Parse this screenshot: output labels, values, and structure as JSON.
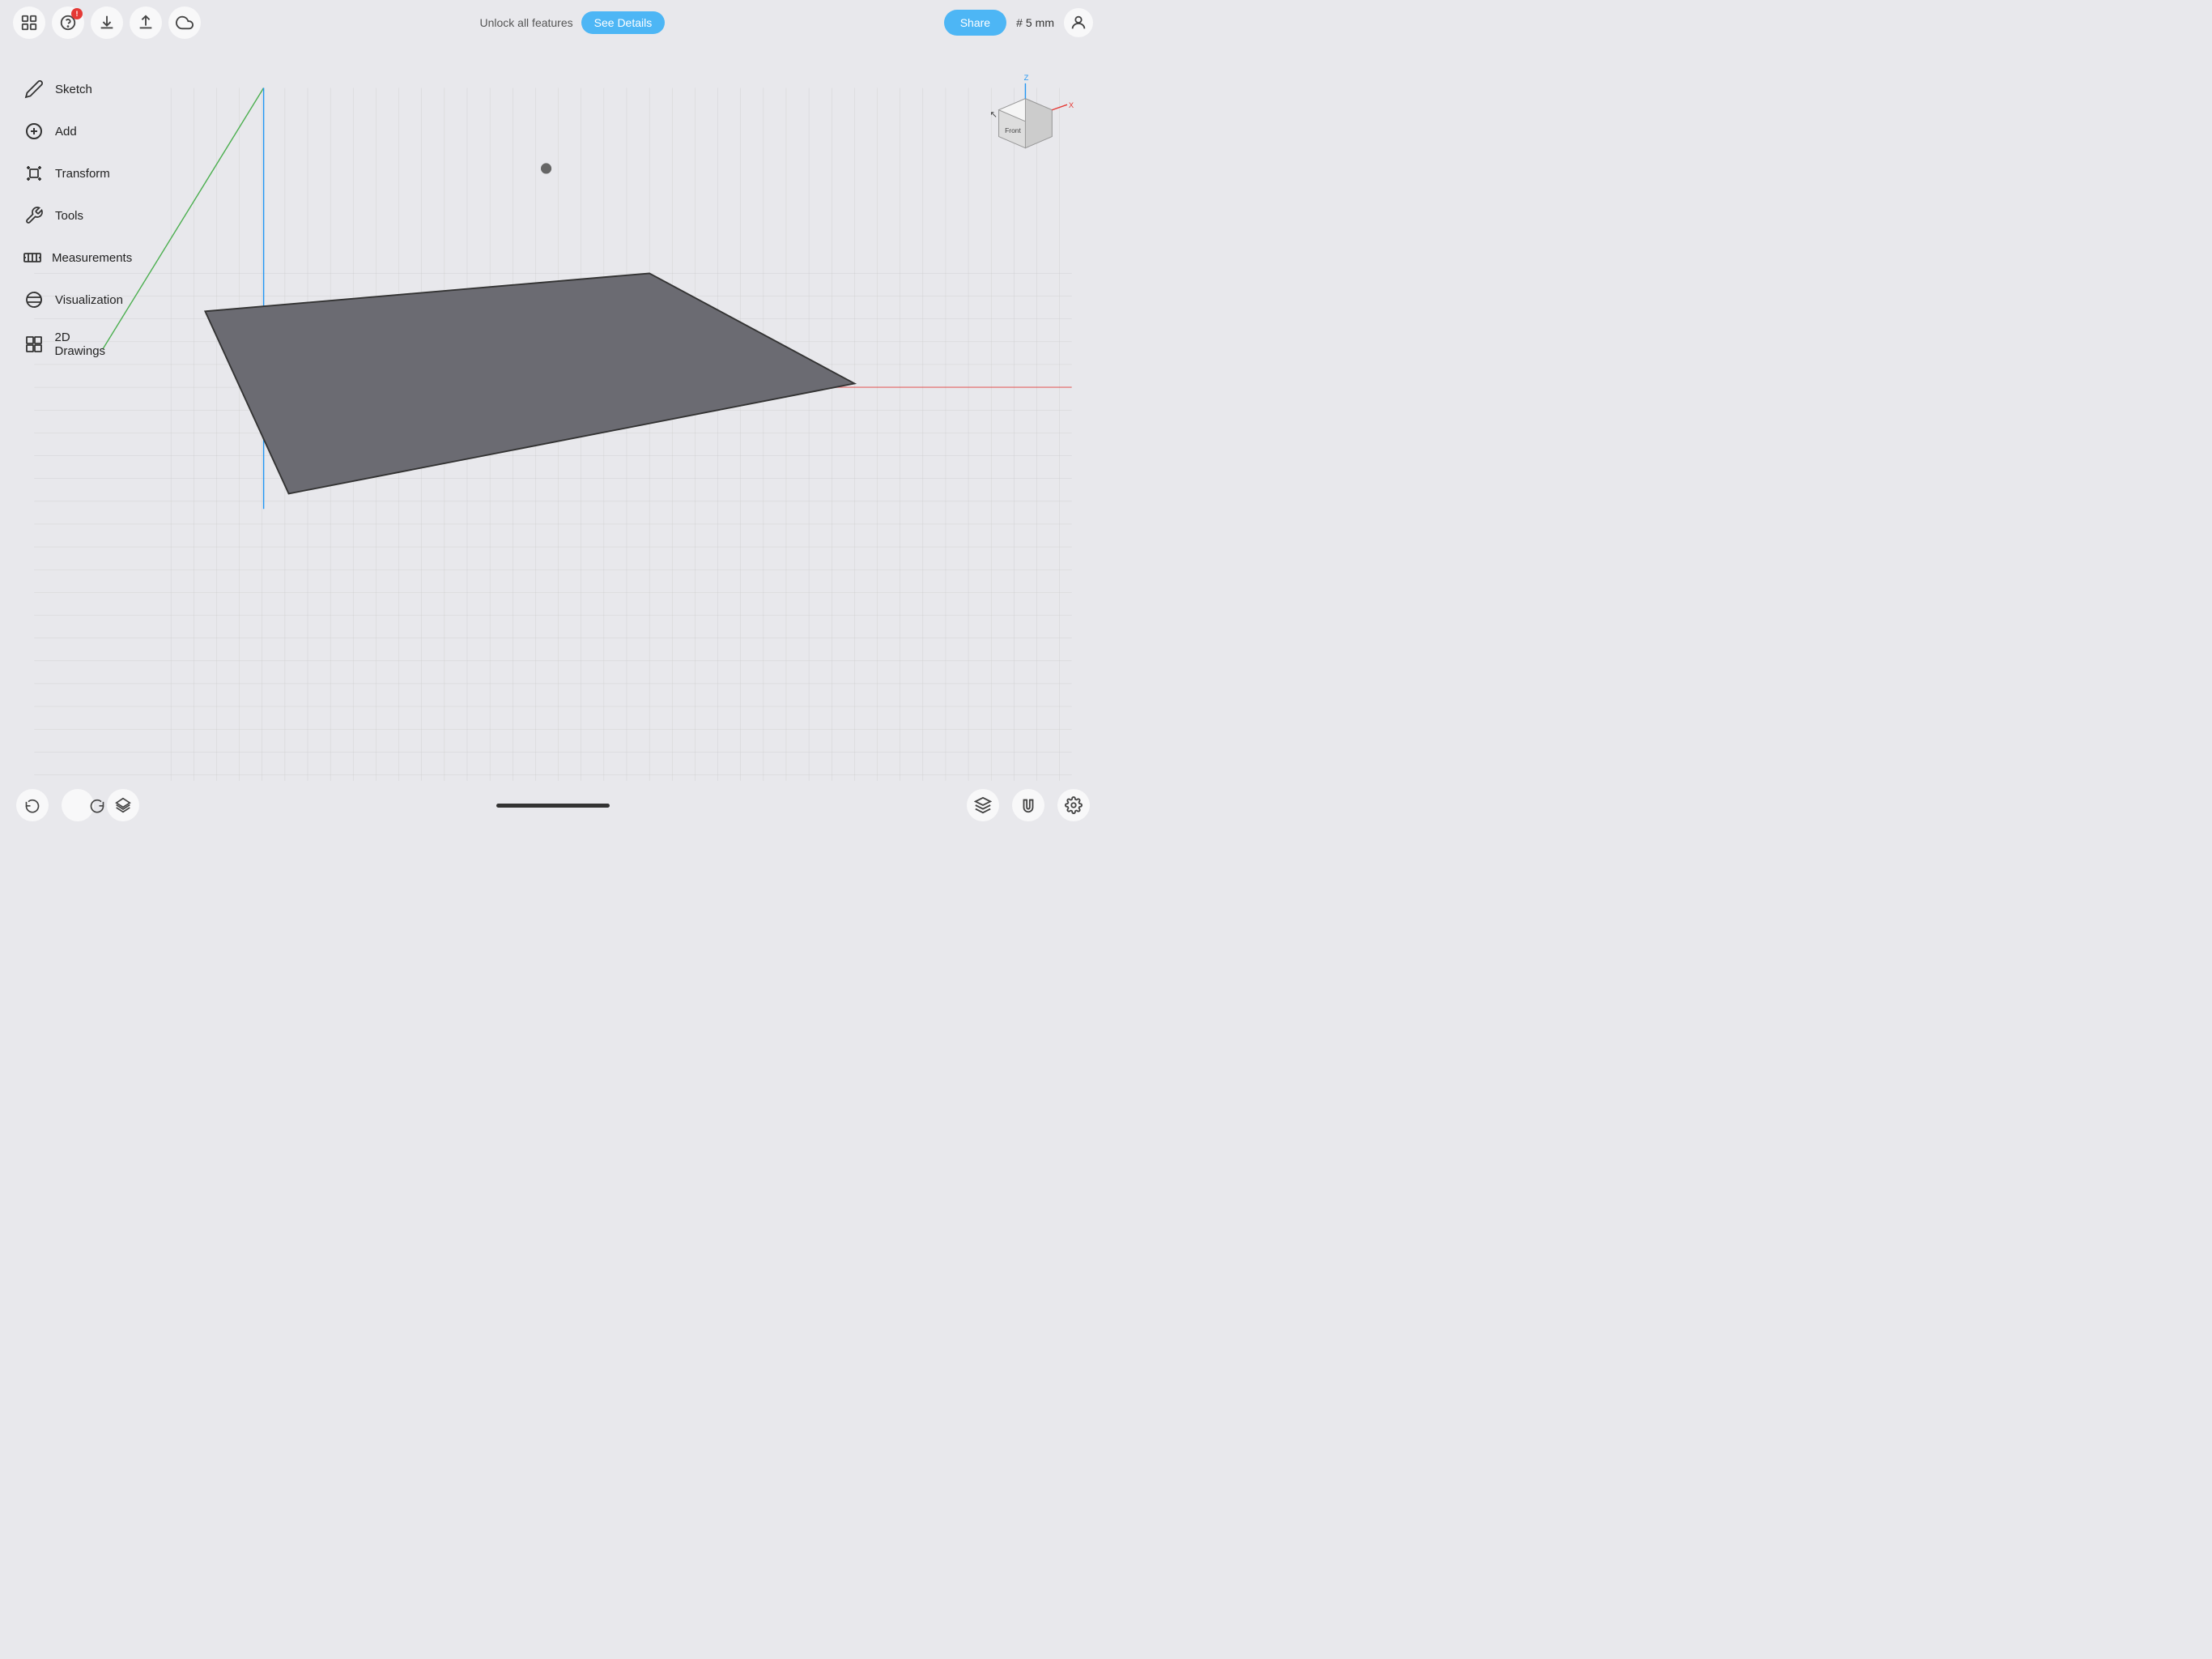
{
  "toolbar": {
    "share_label": "Share",
    "unlock_text": "Unlock all features",
    "see_details_label": "See Details",
    "measurement": {
      "hash": "#",
      "value": "5",
      "unit": "mm"
    }
  },
  "sidebar": {
    "items": [
      {
        "id": "sketch",
        "label": "Sketch",
        "icon": "pencil"
      },
      {
        "id": "add",
        "label": "Add",
        "icon": "plus"
      },
      {
        "id": "transform",
        "label": "Transform",
        "icon": "transform"
      },
      {
        "id": "tools",
        "label": "Tools",
        "icon": "wrench"
      },
      {
        "id": "measurements",
        "label": "Measurements",
        "icon": "measurements"
      },
      {
        "id": "visualization",
        "label": "Visualization",
        "icon": "visualization"
      },
      {
        "id": "2d-drawings",
        "label": "2D Drawings",
        "icon": "drawings"
      }
    ]
  },
  "viewport": {
    "grid_color": "#d0d0d6",
    "axis_label": "Front",
    "x_color": "#e53935",
    "y_color": "#4caf50",
    "z_color": "#2196f3"
  },
  "bottom_toolbar": {
    "undo_label": "Undo",
    "redo_label": "Redo",
    "layers_label": "Layers"
  }
}
